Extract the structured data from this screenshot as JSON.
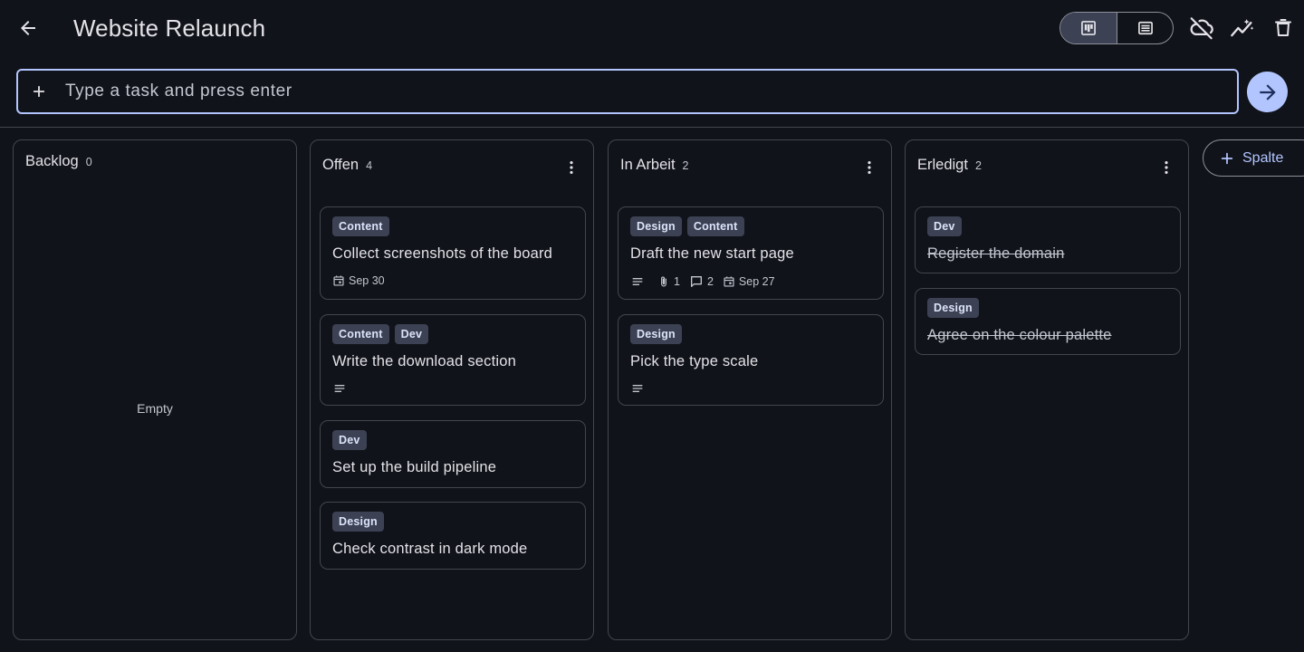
{
  "header": {
    "title": "Website Relaunch",
    "back_icon": "arrow-back-icon",
    "view_modes": [
      {
        "icon": "board-view-icon",
        "active": true
      },
      {
        "icon": "list-view-icon",
        "active": false
      }
    ],
    "actions": [
      "cloud-off-icon",
      "insights-icon",
      "delete-icon"
    ]
  },
  "task_input": {
    "placeholder": "Type a task and press enter",
    "value": ""
  },
  "colors": {
    "accent": "#b2c5ff",
    "background": "#11131a",
    "tag_bg": "#3c4254",
    "border": "#44464f"
  },
  "columns": [
    {
      "name": "Backlog",
      "count": "0",
      "empty_label": "Empty",
      "cards": []
    },
    {
      "name": "Offen",
      "count": "4",
      "cards": [
        {
          "tags": [
            "Content"
          ],
          "title": "Collect screenshots of the board",
          "date": "Sep 30"
        },
        {
          "tags": [
            "Content",
            "Dev"
          ],
          "title": "Write the download section",
          "has_description": true
        },
        {
          "tags": [
            "Dev"
          ],
          "title": "Set up the build pipeline"
        },
        {
          "tags": [
            "Design"
          ],
          "title": "Check contrast in dark mode"
        }
      ]
    },
    {
      "name": "In Arbeit",
      "count": "2",
      "cards": [
        {
          "tags": [
            "Design",
            "Content"
          ],
          "title": "Draft the new start page",
          "has_description": true,
          "attachments": "1",
          "comments": "2",
          "date": "Sep 27"
        },
        {
          "tags": [
            "Design"
          ],
          "title": "Pick the type scale",
          "has_description": true
        }
      ]
    },
    {
      "name": "Erledigt",
      "count": "2",
      "cards": [
        {
          "tags": [
            "Dev"
          ],
          "title": "Register the domain",
          "done": true
        },
        {
          "tags": [
            "Design"
          ],
          "title": "Agree on the colour palette",
          "done": true
        }
      ]
    }
  ],
  "add_column": {
    "label": "Spalte"
  }
}
